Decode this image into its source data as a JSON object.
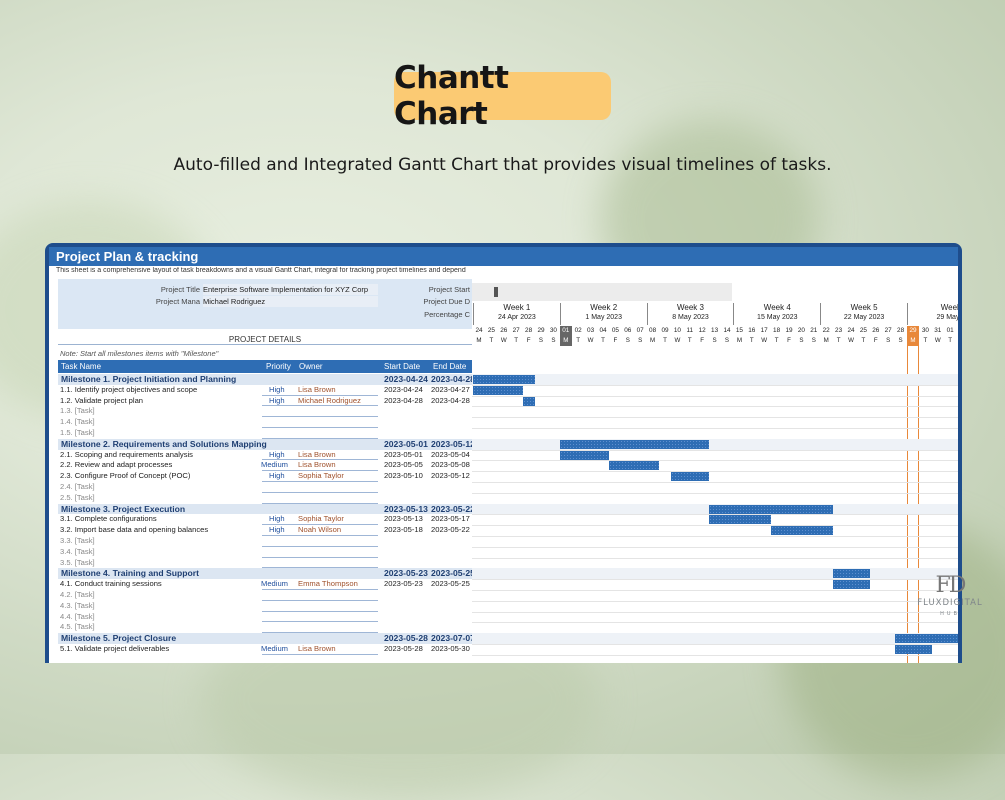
{
  "hero": {
    "title": "Chantt Chart",
    "subtitle": "Auto-filled and Integrated Gantt Chart that provides visual timelines of tasks."
  },
  "sheet": {
    "band_title": "Project Plan & tracking",
    "description": "This sheet is a comprehensive layout of task breakdowns and a visual Gantt Chart, integral for tracking project timelines and depend",
    "project_title_label": "Project Title",
    "project_title_value": "Enterprise Software Implementation for XYZ Corp",
    "project_manager_label": "Project Mana",
    "project_manager_value": "Michael Rodriguez",
    "project_start_label": "Project Start",
    "project_due_label": "Project Due D",
    "percentage_label": "Percentage C",
    "details_label": "PROJECT DETAILS",
    "note": "Note: Start all milestones items with \"Milestone\"",
    "columns": {
      "task": "Task Name",
      "priority": "Priority",
      "owner": "Owner",
      "start": "Start Date",
      "end": "End Date"
    }
  },
  "rows": [
    {
      "type": "milestone",
      "name": "Milestone 1. Project Initiation and Planning",
      "start": "2023-04-24",
      "end": "2023-04-28",
      "s": 0,
      "e": 4
    },
    {
      "type": "task",
      "name": "1.1. Identify project objectives and scope",
      "priority": "High",
      "owner": "Lisa Brown",
      "start": "2023-04-24",
      "end": "2023-04-27",
      "s": 0,
      "e": 3
    },
    {
      "type": "task",
      "name": "1.2. Validate project plan",
      "priority": "High",
      "owner": "Michael Rodriguez",
      "start": "2023-04-28",
      "end": "2023-04-28",
      "s": 4,
      "e": 4
    },
    {
      "type": "ph",
      "name": "1.3. [Task]"
    },
    {
      "type": "ph",
      "name": "1.4. [Task]"
    },
    {
      "type": "ph",
      "name": "1.5. [Task]"
    },
    {
      "type": "milestone",
      "name": "Milestone 2. Requirements and Solutions Mapping",
      "start": "2023-05-01",
      "end": "2023-05-12",
      "s": 7,
      "e": 18
    },
    {
      "type": "task",
      "name": "2.1. Scoping and requirements analysis",
      "priority": "High",
      "owner": "Lisa Brown",
      "start": "2023-05-01",
      "end": "2023-05-04",
      "s": 7,
      "e": 10
    },
    {
      "type": "task",
      "name": "2.2. Review and adapt processes",
      "priority": "Medium",
      "owner": "Lisa Brown",
      "start": "2023-05-05",
      "end": "2023-05-08",
      "s": 11,
      "e": 14
    },
    {
      "type": "task",
      "name": "2.3. Configure Proof of Concept (POC)",
      "priority": "High",
      "owner": "Sophia Taylor",
      "start": "2023-05-10",
      "end": "2023-05-12",
      "s": 16,
      "e": 18
    },
    {
      "type": "ph",
      "name": "2.4. [Task]"
    },
    {
      "type": "ph",
      "name": "2.5. [Task]"
    },
    {
      "type": "milestone",
      "name": "Milestone 3. Project Execution",
      "start": "2023-05-13",
      "end": "2023-05-22",
      "s": 19,
      "e": 28
    },
    {
      "type": "task",
      "name": "3.1. Complete configurations",
      "priority": "High",
      "owner": "Sophia Taylor",
      "start": "2023-05-13",
      "end": "2023-05-17",
      "s": 19,
      "e": 23
    },
    {
      "type": "task",
      "name": "3.2. Import base data and opening balances",
      "priority": "High",
      "owner": "Noah Wilson",
      "start": "2023-05-18",
      "end": "2023-05-22",
      "s": 24,
      "e": 28
    },
    {
      "type": "ph",
      "name": "3.3. [Task]"
    },
    {
      "type": "ph",
      "name": "3.4. [Task]"
    },
    {
      "type": "ph",
      "name": "3.5. [Task]"
    },
    {
      "type": "milestone",
      "name": "Milestone 4. Training and Support",
      "start": "2023-05-23",
      "end": "2023-05-25",
      "s": 29,
      "e": 31
    },
    {
      "type": "task",
      "name": "4.1. Conduct training sessions",
      "priority": "Medium",
      "owner": "Emma Thompson",
      "start": "2023-05-23",
      "end": "2023-05-25",
      "s": 29,
      "e": 31
    },
    {
      "type": "ph",
      "name": "4.2. [Task]"
    },
    {
      "type": "ph",
      "name": "4.3. [Task]"
    },
    {
      "type": "ph",
      "name": "4.4. [Task]"
    },
    {
      "type": "ph",
      "name": "4.5. [Task]"
    },
    {
      "type": "milestone",
      "name": "Milestone 5. Project Closure",
      "start": "2023-05-28",
      "end": "2023-07-07",
      "s": 34,
      "e": 40
    },
    {
      "type": "task",
      "name": "5.1. Validate project deliverables",
      "priority": "Medium",
      "owner": "Lisa Brown",
      "start": "2023-05-28",
      "end": "2023-05-30",
      "s": 34,
      "e": 36
    }
  ],
  "gantt": {
    "weeks": [
      {
        "label": "Week 1",
        "date": "24 Apr 2023"
      },
      {
        "label": "Week 2",
        "date": "1 May 2023"
      },
      {
        "label": "Week 3",
        "date": "8 May 2023"
      },
      {
        "label": "Week 4",
        "date": "15 May 2023"
      },
      {
        "label": "Week 5",
        "date": "22 May 2023"
      },
      {
        "label": "Week",
        "date": "29 May 2"
      }
    ],
    "days": [
      "24",
      "25",
      "26",
      "27",
      "28",
      "29",
      "30",
      "01",
      "02",
      "03",
      "04",
      "05",
      "06",
      "07",
      "08",
      "09",
      "10",
      "11",
      "12",
      "13",
      "14",
      "15",
      "16",
      "17",
      "18",
      "19",
      "20",
      "21",
      "22",
      "23",
      "24",
      "25",
      "26",
      "27",
      "28",
      "29",
      "30",
      "31",
      "01"
    ],
    "day_letters": [
      "M",
      "T",
      "W",
      "T",
      "F",
      "S",
      "S",
      "M",
      "T",
      "W",
      "T",
      "F",
      "S",
      "S",
      "M",
      "T",
      "W",
      "T",
      "F",
      "S",
      "S",
      "M",
      "T",
      "W",
      "T",
      "F",
      "S",
      "S",
      "M",
      "T",
      "W",
      "T",
      "F",
      "S",
      "S",
      "M",
      "T",
      "W",
      "T"
    ],
    "highlight_gray_index": 7,
    "today_index": 35,
    "bar_color": "#2e6db4",
    "today_color": "#e8883a"
  },
  "logo": {
    "monogram": "FD",
    "name": "FLUXDIGITAL",
    "tag": "HUB"
  }
}
